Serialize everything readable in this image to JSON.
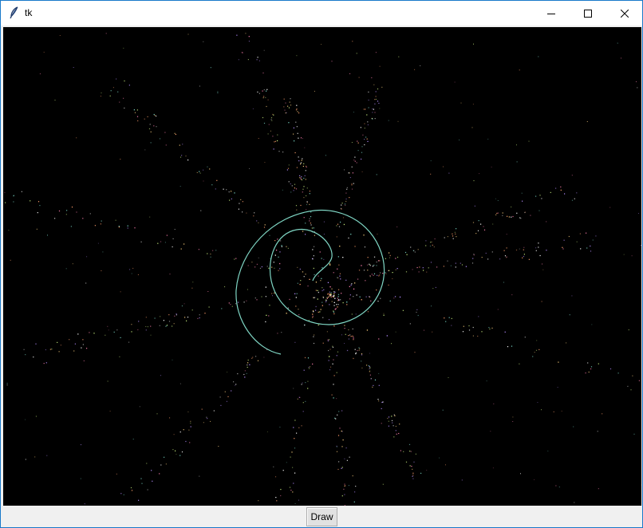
{
  "window": {
    "title": "tk",
    "controls": {
      "minimize_icon": "minimize-icon",
      "maximize_icon": "maximize-icon",
      "close_icon": "close-icon"
    }
  },
  "canvas": {
    "background": "#000000",
    "curve_color": "#7fd6c4",
    "particle_colors": [
      "#ff7fb0",
      "#ffd27f",
      "#c9f07f",
      "#7fe0d0",
      "#ffffff",
      "#b48cff",
      "#ff9f6b"
    ]
  },
  "toolbar": {
    "draw_label": "Draw"
  }
}
